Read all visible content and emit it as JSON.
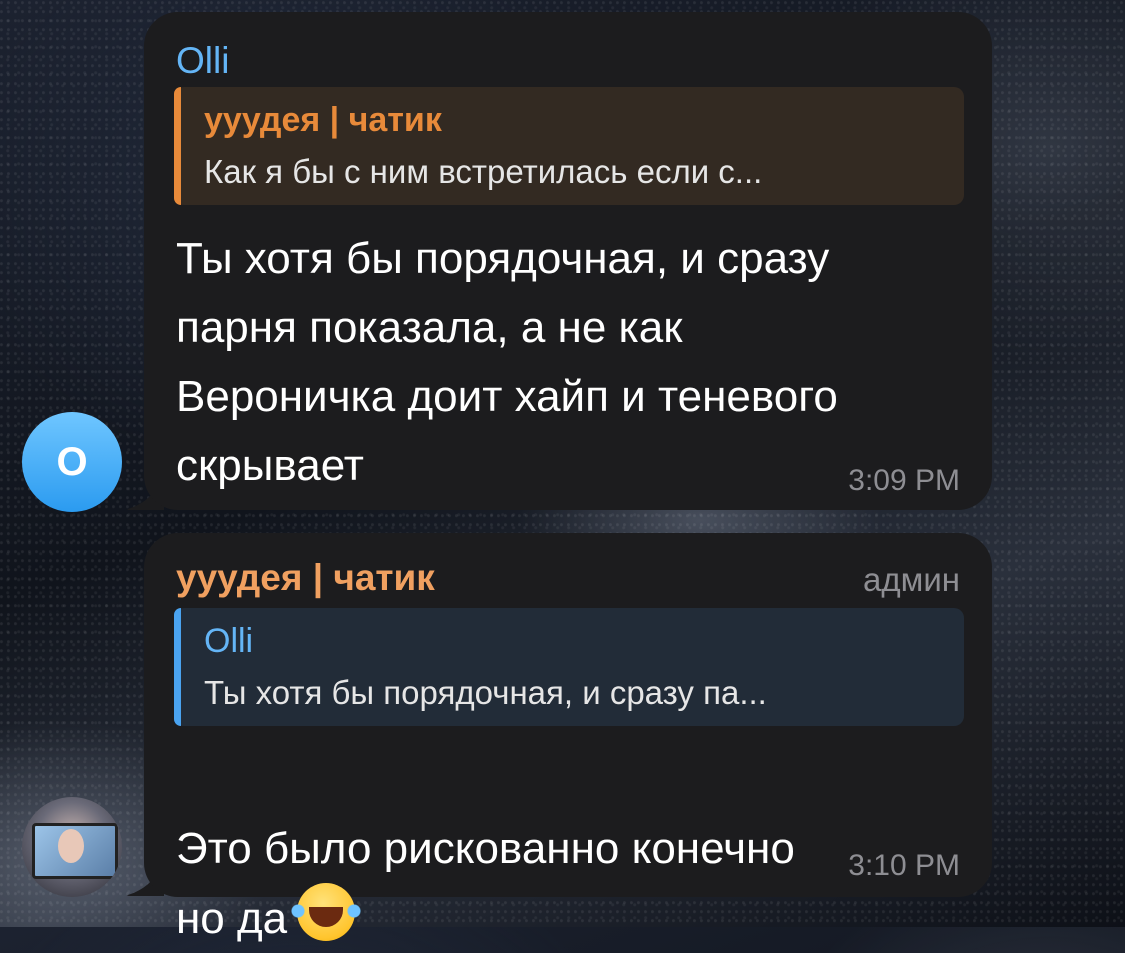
{
  "messages": [
    {
      "sender": "Olli",
      "sender_color": "#64b5f6",
      "avatar_letter": "O",
      "reply": {
        "name": "ууудея | чатик",
        "text": "Как я бы с ним встретилась если с...",
        "accent": "#e88a3a"
      },
      "text": "Ты хотя бы порядочная, и сразу\nпарня показала, а не как\nВероничка доит хайп и теневого\nскрывает",
      "time": "3:09 PM"
    },
    {
      "sender": "ууудея | чатик",
      "sender_color": "#f0a060",
      "badge": "админ",
      "reply": {
        "name": "Olli",
        "text": "Ты хотя бы порядочная, и сразу па...",
        "accent": "#4aa3f0"
      },
      "text": "Это было рискованно конечно\nно да",
      "emoji": "rolling-laughing-emoji",
      "time": "3:10 PM"
    }
  ]
}
